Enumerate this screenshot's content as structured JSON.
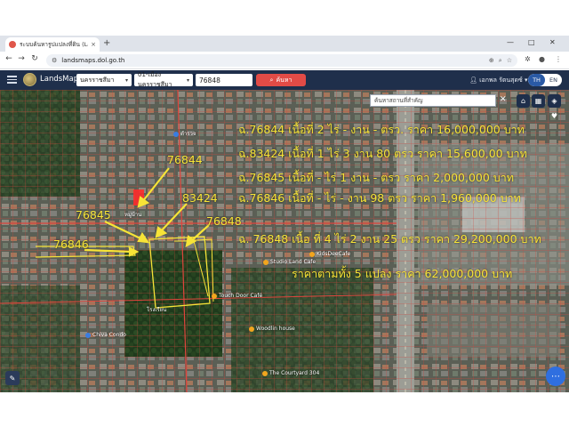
{
  "browser": {
    "tab_title": "ระบบค้นหารูปแปลงที่ดิน (LandsMaps)",
    "tab_close": "×",
    "new_tab": "+",
    "url": "landsmaps.dol.go.th",
    "win_min": "—",
    "win_max": "□",
    "win_close": "✕"
  },
  "app": {
    "brand": "LandsMaps",
    "province": "นครราชสีมา",
    "district": "01-เมืองนครราชสีมา",
    "parcel_no": "76848",
    "search_label": "ค้นหา",
    "user_name": "เอกพล รัตนสุดซ์",
    "lang_th": "TH",
    "lang_en": "EN"
  },
  "map": {
    "place_search_placeholder": "ค้นหาสถานที่สำคัญ",
    "close_symbol": "✕",
    "parcel_labels": [
      "76844",
      "83424",
      "76845",
      "76848",
      "76846"
    ],
    "annotations": [
      "ฉ.76844 เนื้อที่ 2 ไร่ - งาน - ตรว. ราคา 16,000,000 บาท",
      "ฉ.83424 เนื้อที่ 1 ไร่ 3 งาน 80 ตรว ราคา 15,600,00 บาท",
      "ฉ.76845 เนื้อที่ - ไร่ 1 งาน - ตรว ราคา 2,000,000 บาท",
      "ฉ.76846 เนื้อที่ - ไร่ - งาน 98 ตรว ราคา 1,960,000 บาท",
      "ฉ. 76848 เนื้อ ที่ 4 ไร่ 2 งาน 25 ตรว ราคา 29,200,000 บาท",
      "ราคาตามทั้ง 5 แปลง ราคา 62,000,000 บาท"
    ],
    "pois": {
      "touch_door": "Touch Door Café",
      "woodlin": "Woodlin house",
      "courtyard": "The Courtyard 304",
      "chiva": "Chiva Condo",
      "kids": "KidsDeeCafe",
      "studio": "Studio Land Cafe",
      "police": "ตำรวจ",
      "village": "หมู่บ้าน",
      "school": "โรงเรียน"
    }
  },
  "colors": {
    "header_bg": "#1f2f4b",
    "search_btn": "#e24b46",
    "annotation": "#f7e437",
    "parcel_line": "#e0443c",
    "fab": "#2f6fe0"
  }
}
